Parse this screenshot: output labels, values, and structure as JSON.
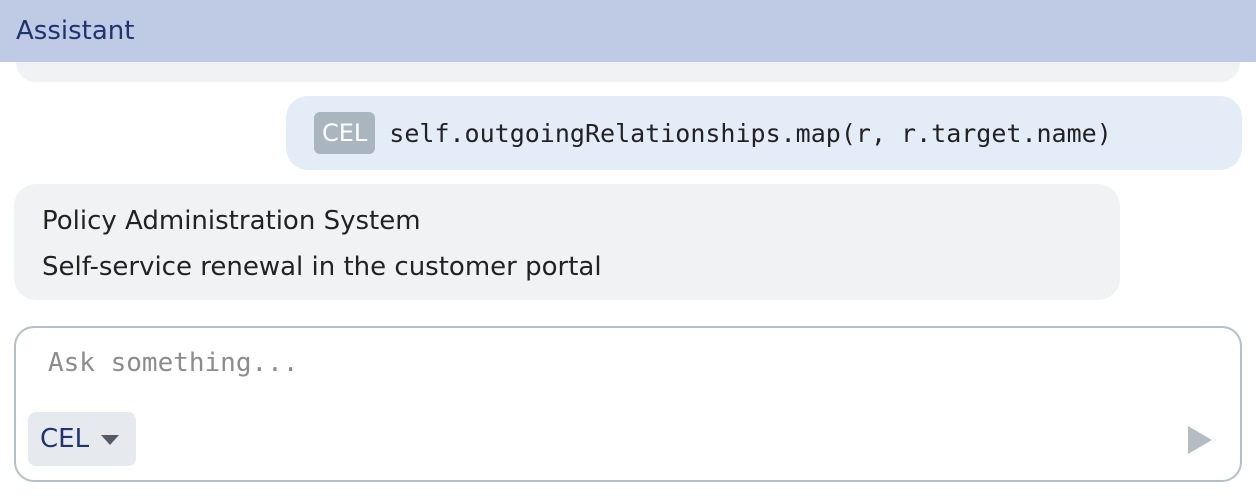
{
  "header": {
    "title": "Assistant"
  },
  "messages": {
    "user_query": {
      "language_badge": "CEL",
      "text": "self.outgoingRelationships.map(r, r.target.name)"
    },
    "reply": {
      "lines": [
        "Policy Administration System",
        "Self-service renewal in the customer portal"
      ]
    }
  },
  "composer": {
    "placeholder": "Ask something...",
    "value": "",
    "language_select": {
      "selected": "CEL"
    },
    "send_icon": "play-icon"
  },
  "colors": {
    "header_bg": "#bfcae5",
    "header_text": "#1f3370",
    "user_bubble_bg": "#e3ecf7",
    "reply_bubble_bg": "#f1f2f4",
    "badge_bg": "#a9b6bf",
    "composer_border": "#b4bfc9"
  }
}
